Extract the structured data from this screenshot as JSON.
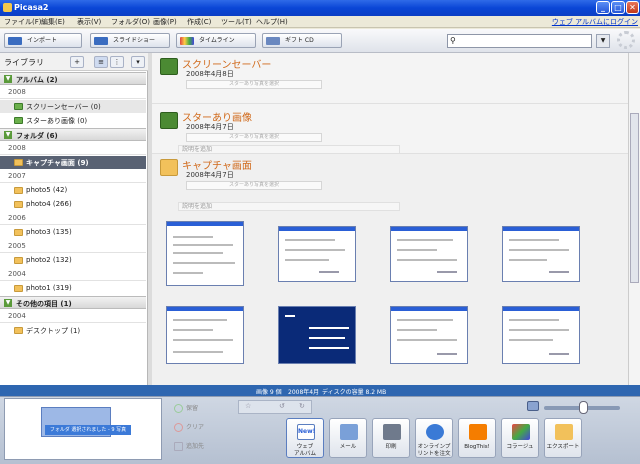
{
  "window": {
    "title": "Picasa2"
  },
  "menu": {
    "items": [
      "ファイル(F)",
      "編集(E)",
      "表示(V)",
      "フォルダ(O)",
      "画像(P)",
      "作成(C)",
      "ツール(T)",
      "ヘルプ(H)"
    ],
    "web_link": "ウェブ アルバムにログイン"
  },
  "toolbar": {
    "import": "インポート",
    "slideshow": "スライドショー",
    "timeline": "タイムライン",
    "giftcd": "ギフト CD",
    "search_value": ""
  },
  "library": {
    "title": "ライブラリ",
    "groups": {
      "album": "アルバム (2)",
      "folder": "フォルダ (6)",
      "other": "その他の項目 (1)"
    },
    "years": {
      "y2008a": "2008",
      "y2008b": "2008",
      "y2007": "2007",
      "y2006": "2006",
      "y2005": "2005",
      "y2004a": "2004",
      "y2004b": "2004"
    },
    "items": {
      "screensaver": "スクリーンセーバー (0)",
      "starred": "スターあり画像 (0)",
      "capture": "キャプチャ画面 (9)",
      "photo5": "photo5 (42)",
      "photo4": "photo4 (266)",
      "photo3": "photo3 (135)",
      "photo2": "photo2 (132)",
      "photo1": "photo1 (319)",
      "desktop": "デスクトップ (1)"
    }
  },
  "main": {
    "sections": {
      "s1": {
        "title": "スクリーンセーバー",
        "date": "2008年4月8日",
        "starbtn": "スターあり写真を選択"
      },
      "s2": {
        "title": "スターあり画像",
        "date": "2008年4月7日",
        "starbtn": "スターあり写真を選択",
        "caption": "説明を追加"
      },
      "s3": {
        "title": "キャプチャ画面",
        "date": "2008年4月7日",
        "starbtn": "スターあり写真を選択",
        "caption": "説明を追加"
      }
    }
  },
  "infobar": {
    "images": "画像 9 個",
    "date": "2008年4月",
    "disk": "ディスクの容量 8.2 MB"
  },
  "tray": {
    "label": "フォルダ 選択されました - 9 写真",
    "hold": "保留",
    "clear": "クリア",
    "add": "追加先"
  },
  "actions": {
    "web_album_badge": "New!",
    "web_album": "ウェブ\nアルバム",
    "mail": "メール",
    "print": "印刷",
    "order": "オンラインプリントを注文",
    "blog": "BlogThis!",
    "collage": "コラージュ",
    "export": "エクスポート"
  },
  "colors": {
    "title_accent": "#d0691a",
    "selected": "#596273",
    "titlebar": "#0a46d6"
  }
}
